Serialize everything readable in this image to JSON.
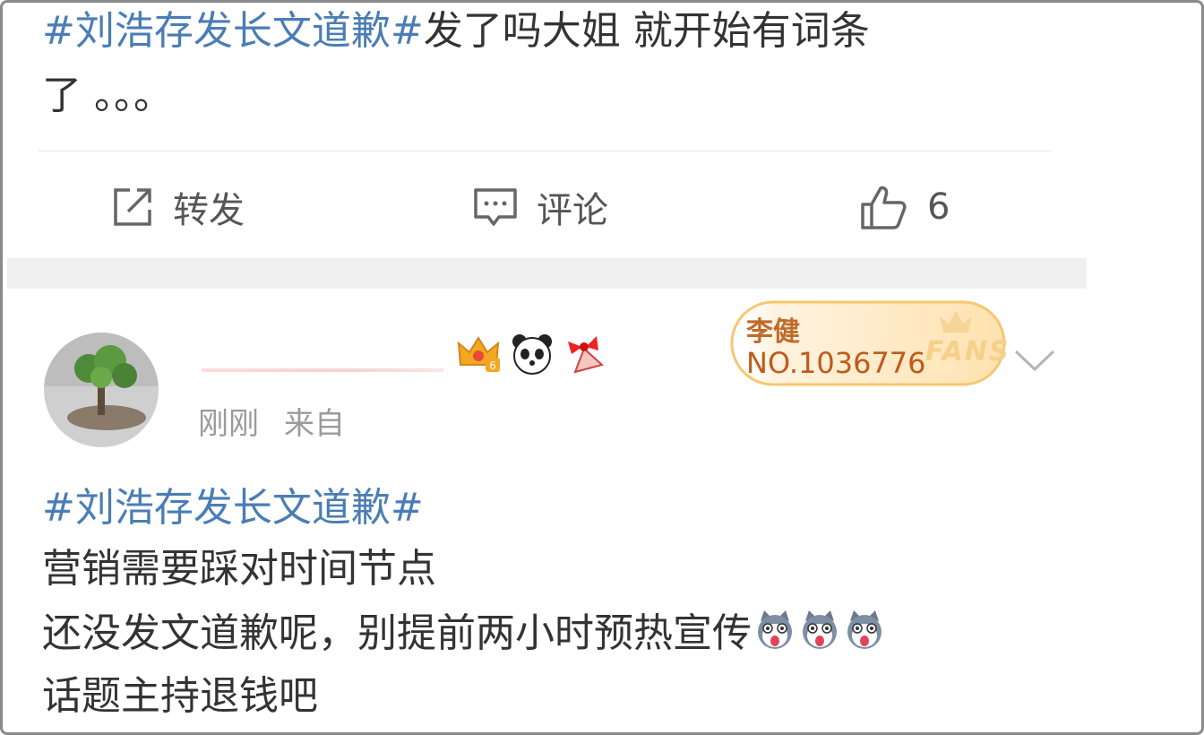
{
  "post_top": {
    "topic": "#刘浩存发长文道歉#",
    "text_line1_rest": "发了吗大姐 就开始有词条",
    "text_line2": "了 。。。"
  },
  "actions": {
    "repost_label": "转发",
    "comment_label": "评论",
    "like_count": "6"
  },
  "comment": {
    "time": "刚刚",
    "source": "来自",
    "fans_badge": {
      "idol_name": "李健",
      "number": "NO.1036776",
      "word": "FANS"
    },
    "topic": "#刘浩存发长文道歉#",
    "lines": [
      "营销需要踩对时间节点",
      "还没发文道歉呢，别提前两小时预热宣传",
      "话题主持退钱吧"
    ],
    "emoji_names": [
      "husky-tongue-emoji",
      "husky-tongue-emoji",
      "husky-tongue-emoji"
    ]
  },
  "colors": {
    "topic_blue": "#4a7db5",
    "text": "#333333",
    "meta_gray": "#9a9a9a",
    "fans_orange": "#c05a1a"
  }
}
